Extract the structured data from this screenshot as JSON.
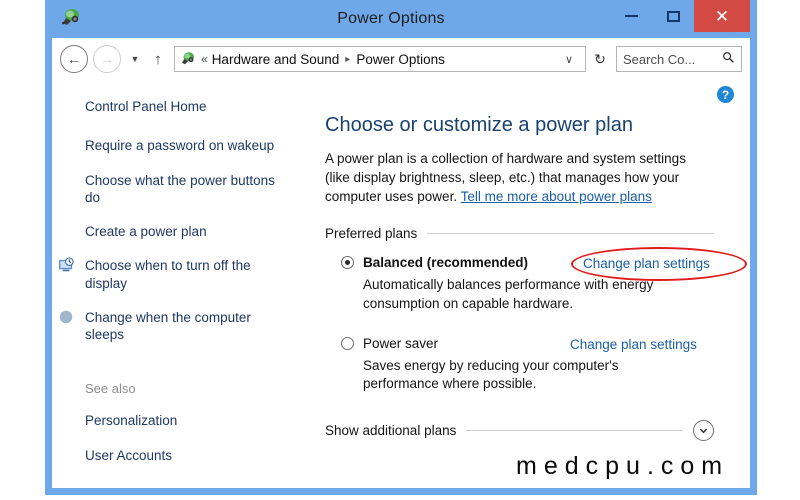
{
  "window": {
    "title": "Power Options",
    "icon": "power-plug-icon",
    "minimize_label": "–",
    "maximize_label": "□",
    "close_label": "✕",
    "accent_color": "#6fa8e8",
    "close_color": "#d24a43"
  },
  "navbar": {
    "back_label": "←",
    "forward_label": "→",
    "history_label": "▼",
    "up_label": "↑",
    "address": {
      "icon": "power-plug-icon",
      "leading": "«",
      "crumbs": [
        "Hardware and Sound",
        "Power Options"
      ],
      "separator": "▸",
      "dropdown_label": "∨"
    },
    "refresh_label": "↻",
    "search": {
      "value": "Search Co...",
      "placeholder": "Search Control Panel",
      "icon": "search-icon"
    }
  },
  "sidebar": {
    "items": [
      {
        "label": "Control Panel Home",
        "icon": null
      },
      {
        "label": "Require a password on wakeup",
        "icon": null
      },
      {
        "label": "Choose what the power buttons do",
        "icon": null
      },
      {
        "label": "Create a power plan",
        "icon": null
      },
      {
        "label": "Choose when to turn off the display",
        "icon": "display-clock-icon"
      },
      {
        "label": "Change when the computer sleeps",
        "icon": "moon-sleep-icon"
      }
    ],
    "see_also": {
      "heading": "See also",
      "items": [
        {
          "label": "Personalization"
        },
        {
          "label": "User Accounts"
        }
      ]
    }
  },
  "content": {
    "help_label": "?",
    "title": "Choose or customize a power plan",
    "description_part1": "A power plan is a collection of hardware and system settings (like display brightness, sleep, etc.) that manages how your computer uses power. ",
    "description_link": "Tell me more about power plans",
    "section_heading": "Preferred plans",
    "plans": [
      {
        "name": "Balanced (recommended)",
        "selected": true,
        "bold": true,
        "link": "Change plan settings",
        "annotated": true,
        "description": "Automatically balances performance with energy consumption on capable hardware."
      },
      {
        "name": "Power saver",
        "selected": false,
        "bold": false,
        "link": "Change plan settings",
        "annotated": false,
        "description": "Saves energy by reducing your computer's performance where possible."
      }
    ],
    "expander": {
      "label": "Show additional plans",
      "icon": "chevron-down-icon"
    },
    "annotation_color": "#e01b1b"
  },
  "watermark": {
    "text": "medcpu.com"
  }
}
